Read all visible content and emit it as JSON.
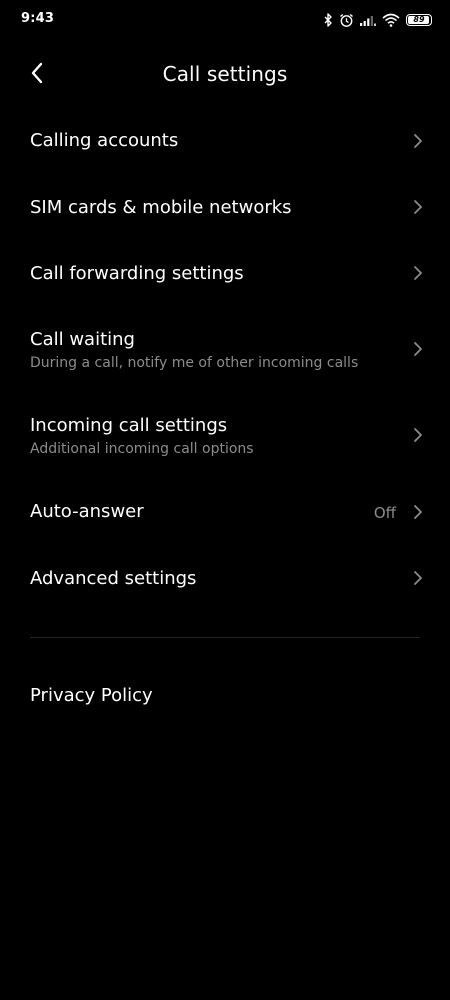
{
  "status_bar": {
    "time": "9:43",
    "battery": "89",
    "icons": [
      "bluetooth-icon",
      "alarm-icon",
      "signal-icon",
      "wifi-icon",
      "battery-icon"
    ]
  },
  "header": {
    "title": "Call settings",
    "back_icon": "back-arrow-icon"
  },
  "settings": {
    "calling_accounts": {
      "title": "Calling accounts"
    },
    "sim_cards": {
      "title": "SIM cards & mobile networks"
    },
    "call_forwarding": {
      "title": "Call forwarding settings"
    },
    "call_waiting": {
      "title": "Call waiting",
      "subtitle": "During a call, notify me of other incoming calls"
    },
    "incoming_call": {
      "title": "Incoming call settings",
      "subtitle": "Additional incoming call options"
    },
    "auto_answer": {
      "title": "Auto-answer",
      "value": "Off"
    },
    "advanced": {
      "title": "Advanced settings"
    },
    "privacy_policy": {
      "title": "Privacy Policy"
    }
  },
  "colors": {
    "background": "#000000",
    "text_primary": "#ffffff",
    "text_secondary": "#8c8c8c",
    "chevron": "#8c8c8c",
    "divider": "#262626"
  }
}
